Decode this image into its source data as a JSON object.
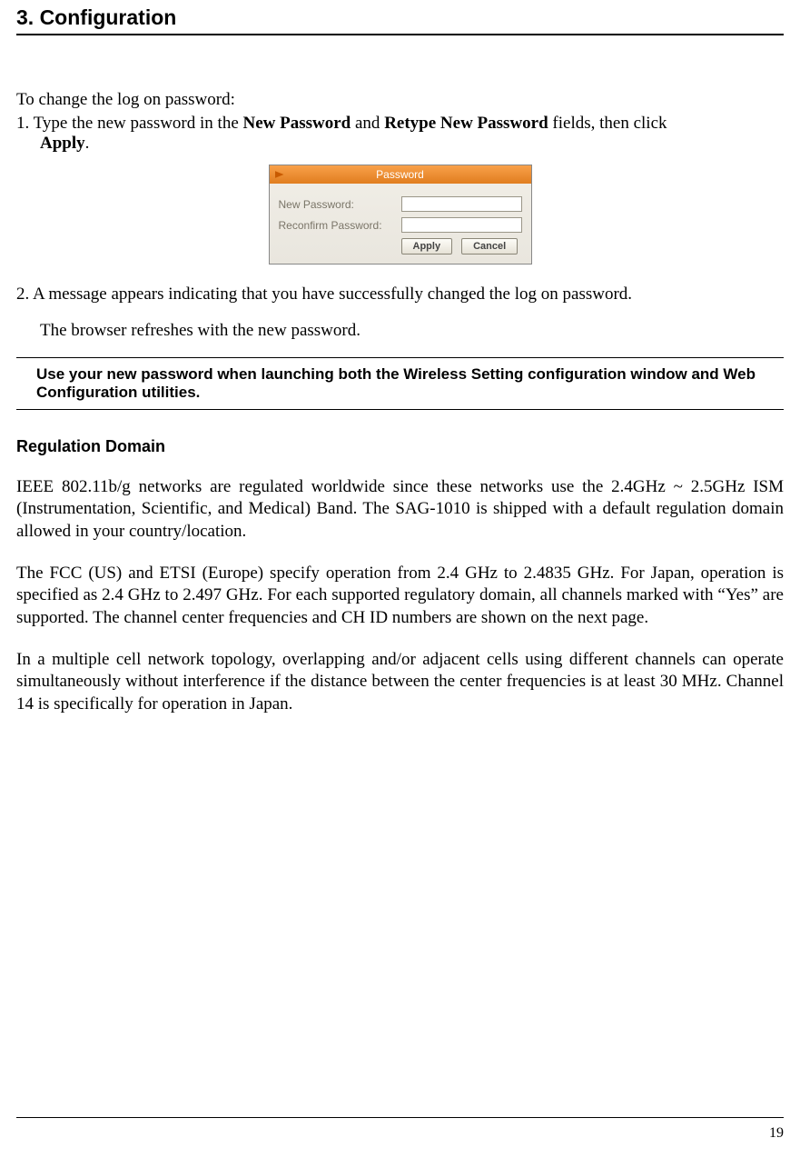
{
  "header": {
    "title": "3. Configuration"
  },
  "intro": "To change the log on password:",
  "step1": {
    "prefix": "1. Type the new password in the ",
    "bold1": "New Password",
    "mid1": " and ",
    "bold2": "Retype New Password",
    "mid2": " fields, then click ",
    "bold3": "Apply",
    "suffix": "."
  },
  "screenshot": {
    "title": "Password",
    "label_new": "New Password:",
    "label_reconfirm": "Reconfirm Password:",
    "btn_apply": "Apply",
    "btn_cancel": "Cancel"
  },
  "step2": {
    "line1": "2. A message appears indicating that you have successfully changed the log on password.",
    "line2": "The browser refreshes with the new password."
  },
  "note": "Use your new password when launching both the Wireless Setting configuration window and Web Configuration utilities.",
  "section": {
    "heading": "Regulation Domain",
    "p1": "IEEE 802.11b/g networks are regulated worldwide since these networks use the 2.4GHz ~ 2.5GHz ISM (Instrumentation, Scientific, and Medical) Band. The SAG-1010 is shipped with a default regulation domain allowed in your country/location.",
    "p2": "The FCC (US) and ETSI (Europe) specify operation from 2.4 GHz to 2.4835 GHz. For Japan, operation is specified as 2.4 GHz to 2.497 GHz. For each supported regulatory domain, all channels marked with “Yes” are supported. The channel center frequencies and CH ID numbers are shown on the next page.",
    "p3": "In a multiple cell network topology, overlapping and/or adjacent cells using different channels can operate simultaneously without interference if the distance between the center frequencies is at least 30 MHz. Channel 14 is specifically for operation in Japan."
  },
  "page_number": "19"
}
